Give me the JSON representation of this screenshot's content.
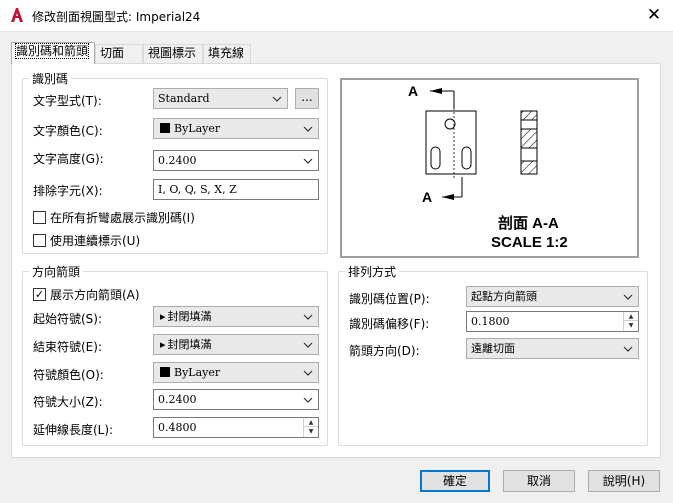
{
  "window": {
    "title": "修改剖面視圖型式: Imperial24",
    "icon": "autocad-icon",
    "close_glyph": "✕"
  },
  "tabs": [
    {
      "label": "識別碼和箭頭",
      "active": true
    },
    {
      "label": "切面",
      "active": false
    },
    {
      "label": "視圖標示",
      "active": false
    },
    {
      "label": "填充線",
      "active": false
    }
  ],
  "identifier_group": {
    "title": "識別碼",
    "text_style_label": "文字型式(T):",
    "text_style_value": "Standard",
    "browse_label": "...",
    "text_color_label": "文字顏色(C):",
    "text_color_value": "ByLayer",
    "text_height_label": "文字高度(G):",
    "text_height_value": "0.2400",
    "exclude_chars_label": "排除字元(X):",
    "exclude_chars_value": "I, O, Q, S, X, Z",
    "show_at_bends_label": "在所有折彎處展示識別碼(I)",
    "show_at_bends_checked": false,
    "continuous_label": "使用連續標示(U)",
    "continuous_checked": false
  },
  "arrows_group": {
    "title": "方向箭頭",
    "show_arrows_label": "展示方向箭頭(A)",
    "show_arrows_checked": true,
    "start_symbol_label": "起始符號(S):",
    "start_symbol_value": "封閉填滿",
    "end_symbol_label": "結束符號(E):",
    "end_symbol_value": "封閉填滿",
    "symbol_color_label": "符號顏色(O):",
    "symbol_color_value": "ByLayer",
    "symbol_size_label": "符號大小(Z):",
    "symbol_size_value": "0.2400",
    "extension_label": "延伸線長度(L):",
    "extension_value": "0.4800"
  },
  "layout_group": {
    "title": "排列方式",
    "id_position_label": "識別碼位置(P):",
    "id_position_value": "起點方向箭頭",
    "id_offset_label": "識別碼偏移(F):",
    "id_offset_value": "0.1800",
    "arrow_dir_label": "箭頭方向(D):",
    "arrow_dir_value": "遠離切面"
  },
  "preview": {
    "label_a_top": "A",
    "label_a_bottom": "A",
    "caption_line1": "剖面 A-A",
    "caption_line2": "SCALE 1:2"
  },
  "buttons": {
    "ok": "確定",
    "cancel": "取消",
    "help": "說明(H)"
  },
  "colors": {
    "accent": "#0078d7",
    "autocad_red": "#c8102e"
  }
}
